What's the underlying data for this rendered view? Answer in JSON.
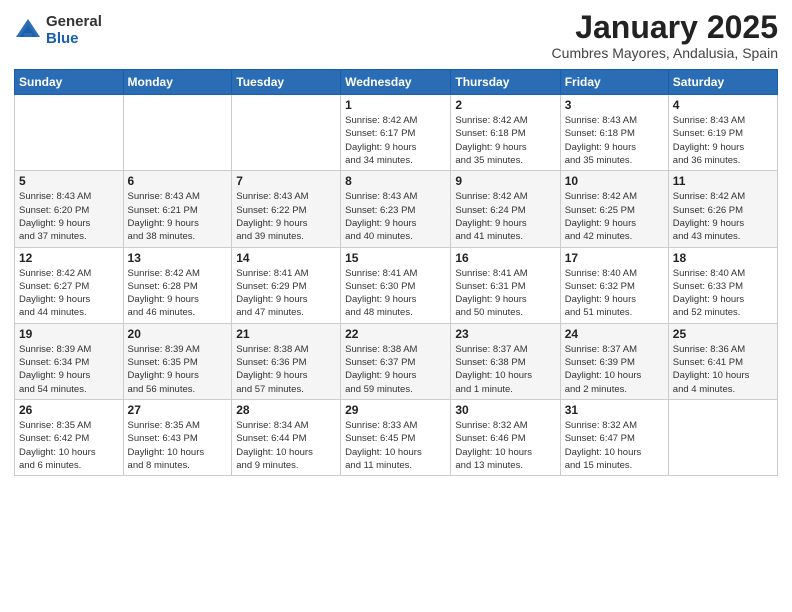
{
  "logo": {
    "general": "General",
    "blue": "Blue"
  },
  "header": {
    "title": "January 2025",
    "location": "Cumbres Mayores, Andalusia, Spain"
  },
  "weekdays": [
    "Sunday",
    "Monday",
    "Tuesday",
    "Wednesday",
    "Thursday",
    "Friday",
    "Saturday"
  ],
  "weeks": [
    [
      {
        "day": "",
        "detail": ""
      },
      {
        "day": "",
        "detail": ""
      },
      {
        "day": "",
        "detail": ""
      },
      {
        "day": "1",
        "detail": "Sunrise: 8:42 AM\nSunset: 6:17 PM\nDaylight: 9 hours\nand 34 minutes."
      },
      {
        "day": "2",
        "detail": "Sunrise: 8:42 AM\nSunset: 6:18 PM\nDaylight: 9 hours\nand 35 minutes."
      },
      {
        "day": "3",
        "detail": "Sunrise: 8:43 AM\nSunset: 6:18 PM\nDaylight: 9 hours\nand 35 minutes."
      },
      {
        "day": "4",
        "detail": "Sunrise: 8:43 AM\nSunset: 6:19 PM\nDaylight: 9 hours\nand 36 minutes."
      }
    ],
    [
      {
        "day": "5",
        "detail": "Sunrise: 8:43 AM\nSunset: 6:20 PM\nDaylight: 9 hours\nand 37 minutes."
      },
      {
        "day": "6",
        "detail": "Sunrise: 8:43 AM\nSunset: 6:21 PM\nDaylight: 9 hours\nand 38 minutes."
      },
      {
        "day": "7",
        "detail": "Sunrise: 8:43 AM\nSunset: 6:22 PM\nDaylight: 9 hours\nand 39 minutes."
      },
      {
        "day": "8",
        "detail": "Sunrise: 8:43 AM\nSunset: 6:23 PM\nDaylight: 9 hours\nand 40 minutes."
      },
      {
        "day": "9",
        "detail": "Sunrise: 8:42 AM\nSunset: 6:24 PM\nDaylight: 9 hours\nand 41 minutes."
      },
      {
        "day": "10",
        "detail": "Sunrise: 8:42 AM\nSunset: 6:25 PM\nDaylight: 9 hours\nand 42 minutes."
      },
      {
        "day": "11",
        "detail": "Sunrise: 8:42 AM\nSunset: 6:26 PM\nDaylight: 9 hours\nand 43 minutes."
      }
    ],
    [
      {
        "day": "12",
        "detail": "Sunrise: 8:42 AM\nSunset: 6:27 PM\nDaylight: 9 hours\nand 44 minutes."
      },
      {
        "day": "13",
        "detail": "Sunrise: 8:42 AM\nSunset: 6:28 PM\nDaylight: 9 hours\nand 46 minutes."
      },
      {
        "day": "14",
        "detail": "Sunrise: 8:41 AM\nSunset: 6:29 PM\nDaylight: 9 hours\nand 47 minutes."
      },
      {
        "day": "15",
        "detail": "Sunrise: 8:41 AM\nSunset: 6:30 PM\nDaylight: 9 hours\nand 48 minutes."
      },
      {
        "day": "16",
        "detail": "Sunrise: 8:41 AM\nSunset: 6:31 PM\nDaylight: 9 hours\nand 50 minutes."
      },
      {
        "day": "17",
        "detail": "Sunrise: 8:40 AM\nSunset: 6:32 PM\nDaylight: 9 hours\nand 51 minutes."
      },
      {
        "day": "18",
        "detail": "Sunrise: 8:40 AM\nSunset: 6:33 PM\nDaylight: 9 hours\nand 52 minutes."
      }
    ],
    [
      {
        "day": "19",
        "detail": "Sunrise: 8:39 AM\nSunset: 6:34 PM\nDaylight: 9 hours\nand 54 minutes."
      },
      {
        "day": "20",
        "detail": "Sunrise: 8:39 AM\nSunset: 6:35 PM\nDaylight: 9 hours\nand 56 minutes."
      },
      {
        "day": "21",
        "detail": "Sunrise: 8:38 AM\nSunset: 6:36 PM\nDaylight: 9 hours\nand 57 minutes."
      },
      {
        "day": "22",
        "detail": "Sunrise: 8:38 AM\nSunset: 6:37 PM\nDaylight: 9 hours\nand 59 minutes."
      },
      {
        "day": "23",
        "detail": "Sunrise: 8:37 AM\nSunset: 6:38 PM\nDaylight: 10 hours\nand 1 minute."
      },
      {
        "day": "24",
        "detail": "Sunrise: 8:37 AM\nSunset: 6:39 PM\nDaylight: 10 hours\nand 2 minutes."
      },
      {
        "day": "25",
        "detail": "Sunrise: 8:36 AM\nSunset: 6:41 PM\nDaylight: 10 hours\nand 4 minutes."
      }
    ],
    [
      {
        "day": "26",
        "detail": "Sunrise: 8:35 AM\nSunset: 6:42 PM\nDaylight: 10 hours\nand 6 minutes."
      },
      {
        "day": "27",
        "detail": "Sunrise: 8:35 AM\nSunset: 6:43 PM\nDaylight: 10 hours\nand 8 minutes."
      },
      {
        "day": "28",
        "detail": "Sunrise: 8:34 AM\nSunset: 6:44 PM\nDaylight: 10 hours\nand 9 minutes."
      },
      {
        "day": "29",
        "detail": "Sunrise: 8:33 AM\nSunset: 6:45 PM\nDaylight: 10 hours\nand 11 minutes."
      },
      {
        "day": "30",
        "detail": "Sunrise: 8:32 AM\nSunset: 6:46 PM\nDaylight: 10 hours\nand 13 minutes."
      },
      {
        "day": "31",
        "detail": "Sunrise: 8:32 AM\nSunset: 6:47 PM\nDaylight: 10 hours\nand 15 minutes."
      },
      {
        "day": "",
        "detail": ""
      }
    ]
  ]
}
